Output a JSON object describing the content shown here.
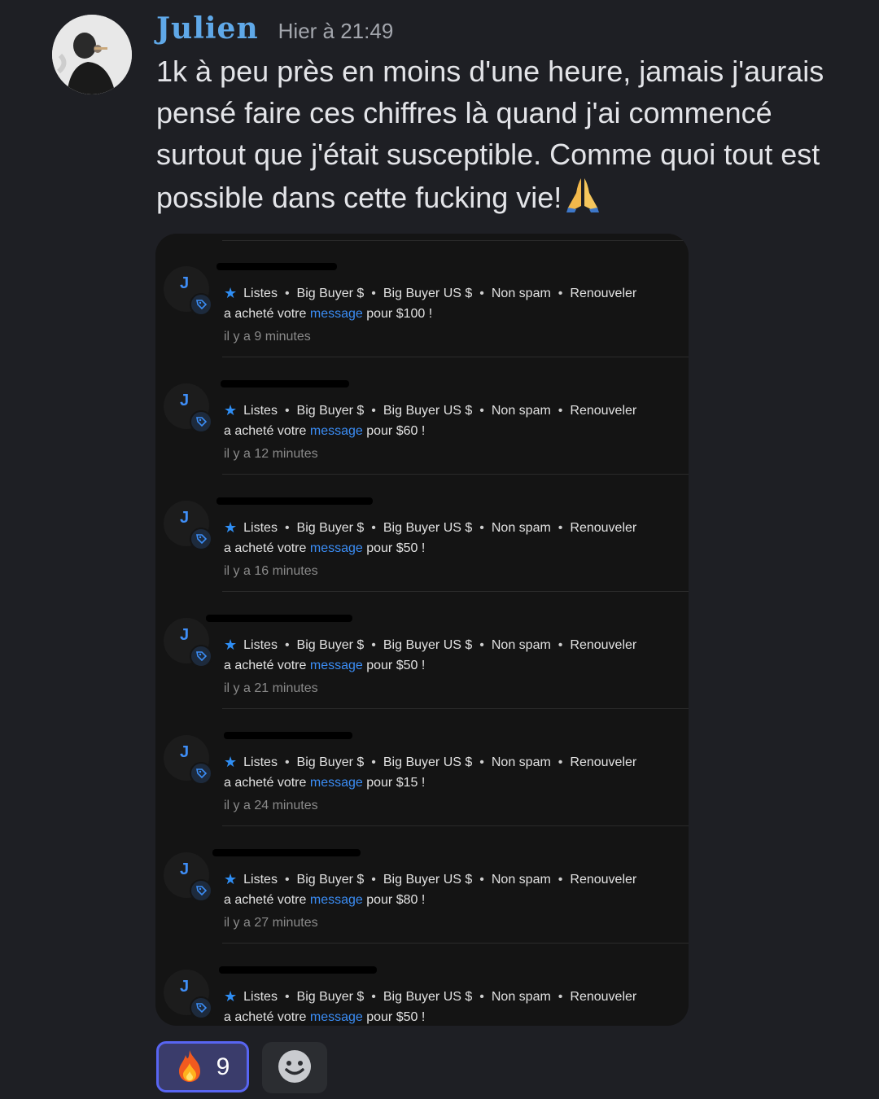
{
  "message": {
    "author": "Julien",
    "timestamp": "Hier à 21:49",
    "text": "1k à peu près en moins d'une heure, jamais j'aurais pensé faire ces chiffres là quand j'ai commencé surtout que j'était susceptible. Comme quoi tout est possible dans cette fucking vie!",
    "emoji_icon": "folded-hands-icon"
  },
  "embed": {
    "avatar_letter": "J",
    "tag_labels": [
      "Listes",
      "Big Buyer $",
      "Big Buyer US $",
      "Non spam",
      "Renouveler"
    ],
    "separator": "•",
    "purchase_prefix": "a acheté votre",
    "purchase_link": "message",
    "notifications": [
      {
        "amount_text": "pour $100 !",
        "time": "il y a 9 minutes"
      },
      {
        "amount_text": "pour $60 !",
        "time": "il y a 12 minutes"
      },
      {
        "amount_text": "pour $50 !",
        "time": "il y a 16 minutes"
      },
      {
        "amount_text": "pour $50 !",
        "time": "il y a 21 minutes"
      },
      {
        "amount_text": "pour $15 !",
        "time": "il y a 24 minutes"
      },
      {
        "amount_text": "pour $80 !",
        "time": "il y a 27 minutes"
      },
      {
        "amount_text": "pour $50 !",
        "time": ""
      }
    ]
  },
  "reactions": {
    "fire_count": "9",
    "fire_icon": "fire-icon",
    "add_icon": "add-reaction-smiley-icon"
  },
  "colors": {
    "background": "#1e1f24",
    "author": "#5fa8e8",
    "link": "#3b8df5",
    "reaction_border": "#5865f2"
  }
}
